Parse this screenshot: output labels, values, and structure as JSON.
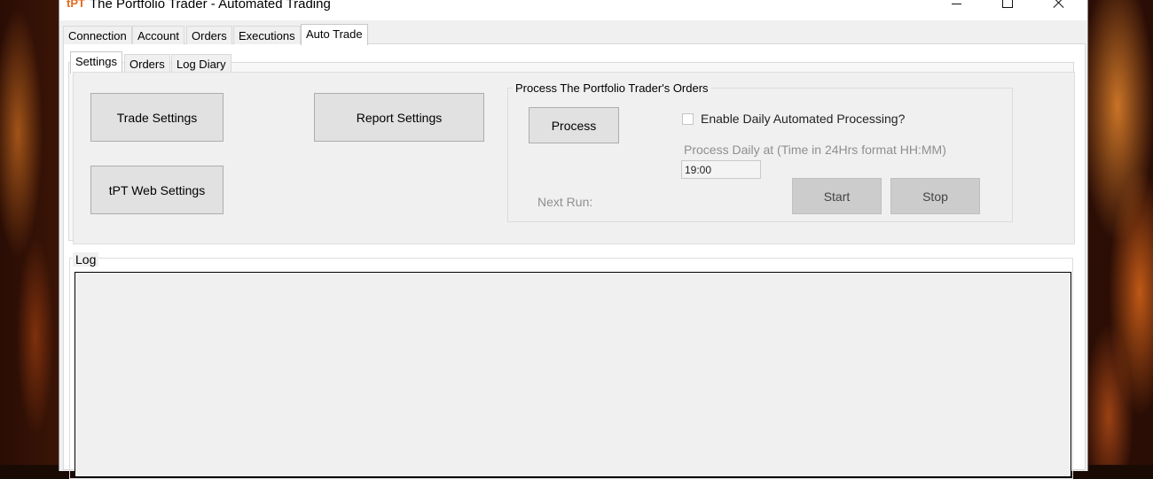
{
  "window": {
    "logo_t": "t",
    "logo_pt": "PT",
    "title": "The Portfolio Trader - Automated Trading"
  },
  "main_tabs": [
    {
      "label": "Connection"
    },
    {
      "label": "Account"
    },
    {
      "label": "Orders"
    },
    {
      "label": "Executions"
    },
    {
      "label": "Auto Trade"
    }
  ],
  "sub_tabs": [
    {
      "label": "Settings"
    },
    {
      "label": "Orders"
    },
    {
      "label": "Log Diary"
    }
  ],
  "settings": {
    "trade_settings_label": "Trade Settings",
    "report_settings_label": "Report Settings",
    "web_settings_label": "tPT Web Settings"
  },
  "process_group": {
    "title": "Process The Portfolio Trader's Orders",
    "process_label": "Process",
    "enable_label": "Enable Daily Automated Processing?",
    "enable_checked": false,
    "daily_label": "Process Daily at (Time in 24Hrs format HH:MM)",
    "time_value": "19:00",
    "next_run_label": "Next Run:",
    "start_label": "Start",
    "stop_label": "Stop"
  },
  "log": {
    "title": "Log"
  },
  "colors": {
    "logo": "#e36a1e",
    "window_bg": "#f0f0f0",
    "button_bg": "#e1e1e1",
    "disabled_button_bg": "#cccccc"
  }
}
